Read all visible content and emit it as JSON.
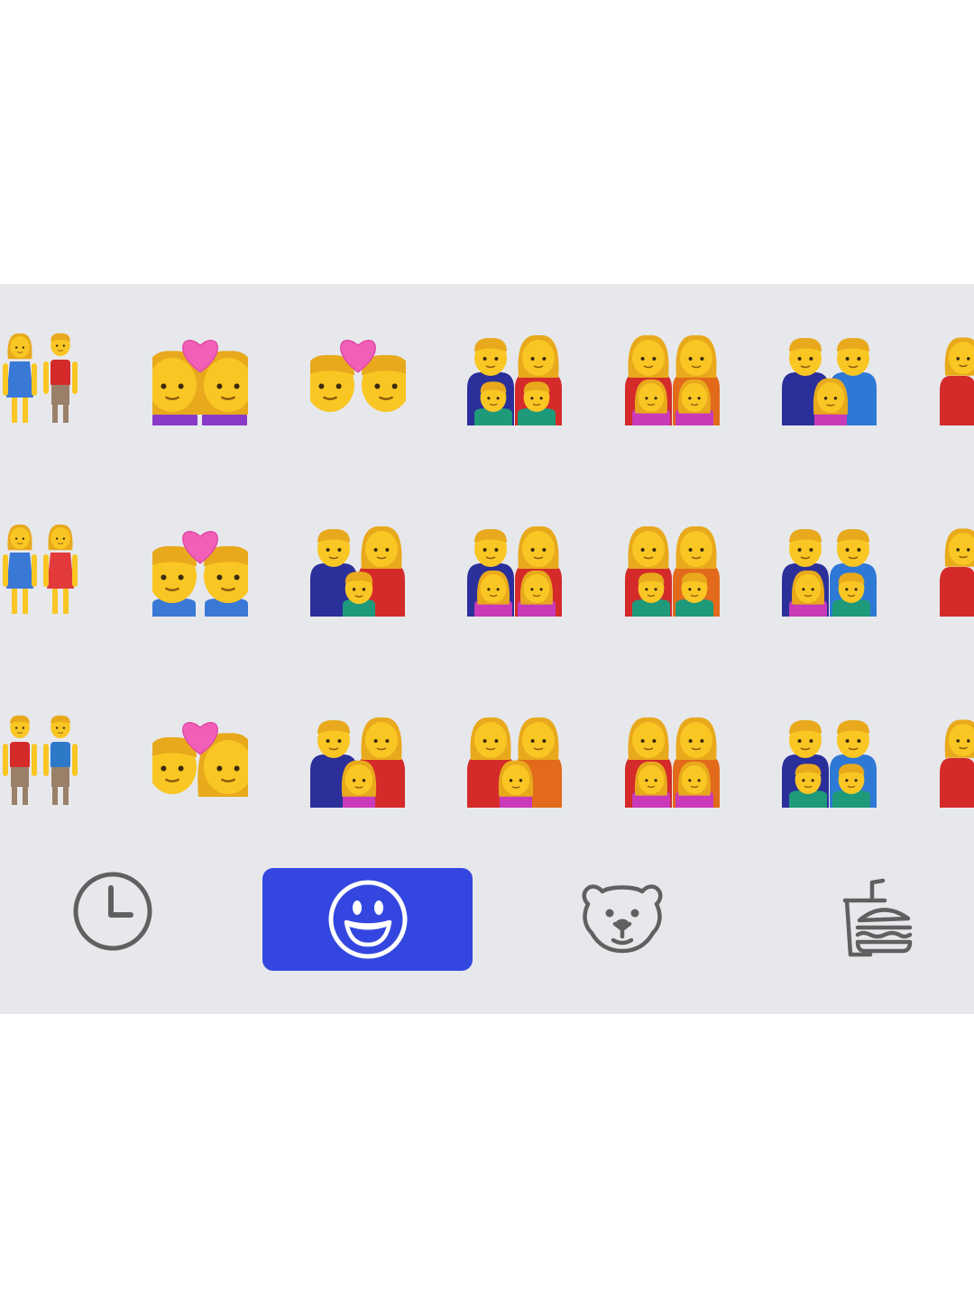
{
  "keyboard": {
    "background": "#e7e8ec",
    "emoji_rows": [
      [
        "couple-man-woman-holding-hands",
        "kiss-woman-woman",
        "kiss-man-man",
        "family-man-woman-boy-boy",
        "family-woman-woman-girl-girl",
        "family-man-man-girl",
        "family-partial"
      ],
      [
        "two-women-holding-hands",
        "couple-with-heart-man-man",
        "family-man-woman-boy",
        "family-man-woman-girl-girl",
        "family-woman-woman-boy-boy",
        "family-man-man-girl-boy",
        "family-partial"
      ],
      [
        "two-men-holding-hands",
        "kiss-man-woman",
        "family-man-woman-girl",
        "family-woman-woman-girl",
        "family-woman-woman-girl-girl",
        "family-man-man-boy-boy",
        "family-partial"
      ]
    ],
    "category_bar": {
      "items": [
        {
          "id": "recent",
          "icon": "clock-icon",
          "active": false
        },
        {
          "id": "smileys-people",
          "icon": "smiley-icon",
          "active": true
        },
        {
          "id": "animals-nature",
          "icon": "bear-icon",
          "active": false
        },
        {
          "id": "food-drink",
          "icon": "burger-drink-icon",
          "active": false
        }
      ],
      "active_color": "#3347e0",
      "icon_color": "#606060"
    }
  }
}
